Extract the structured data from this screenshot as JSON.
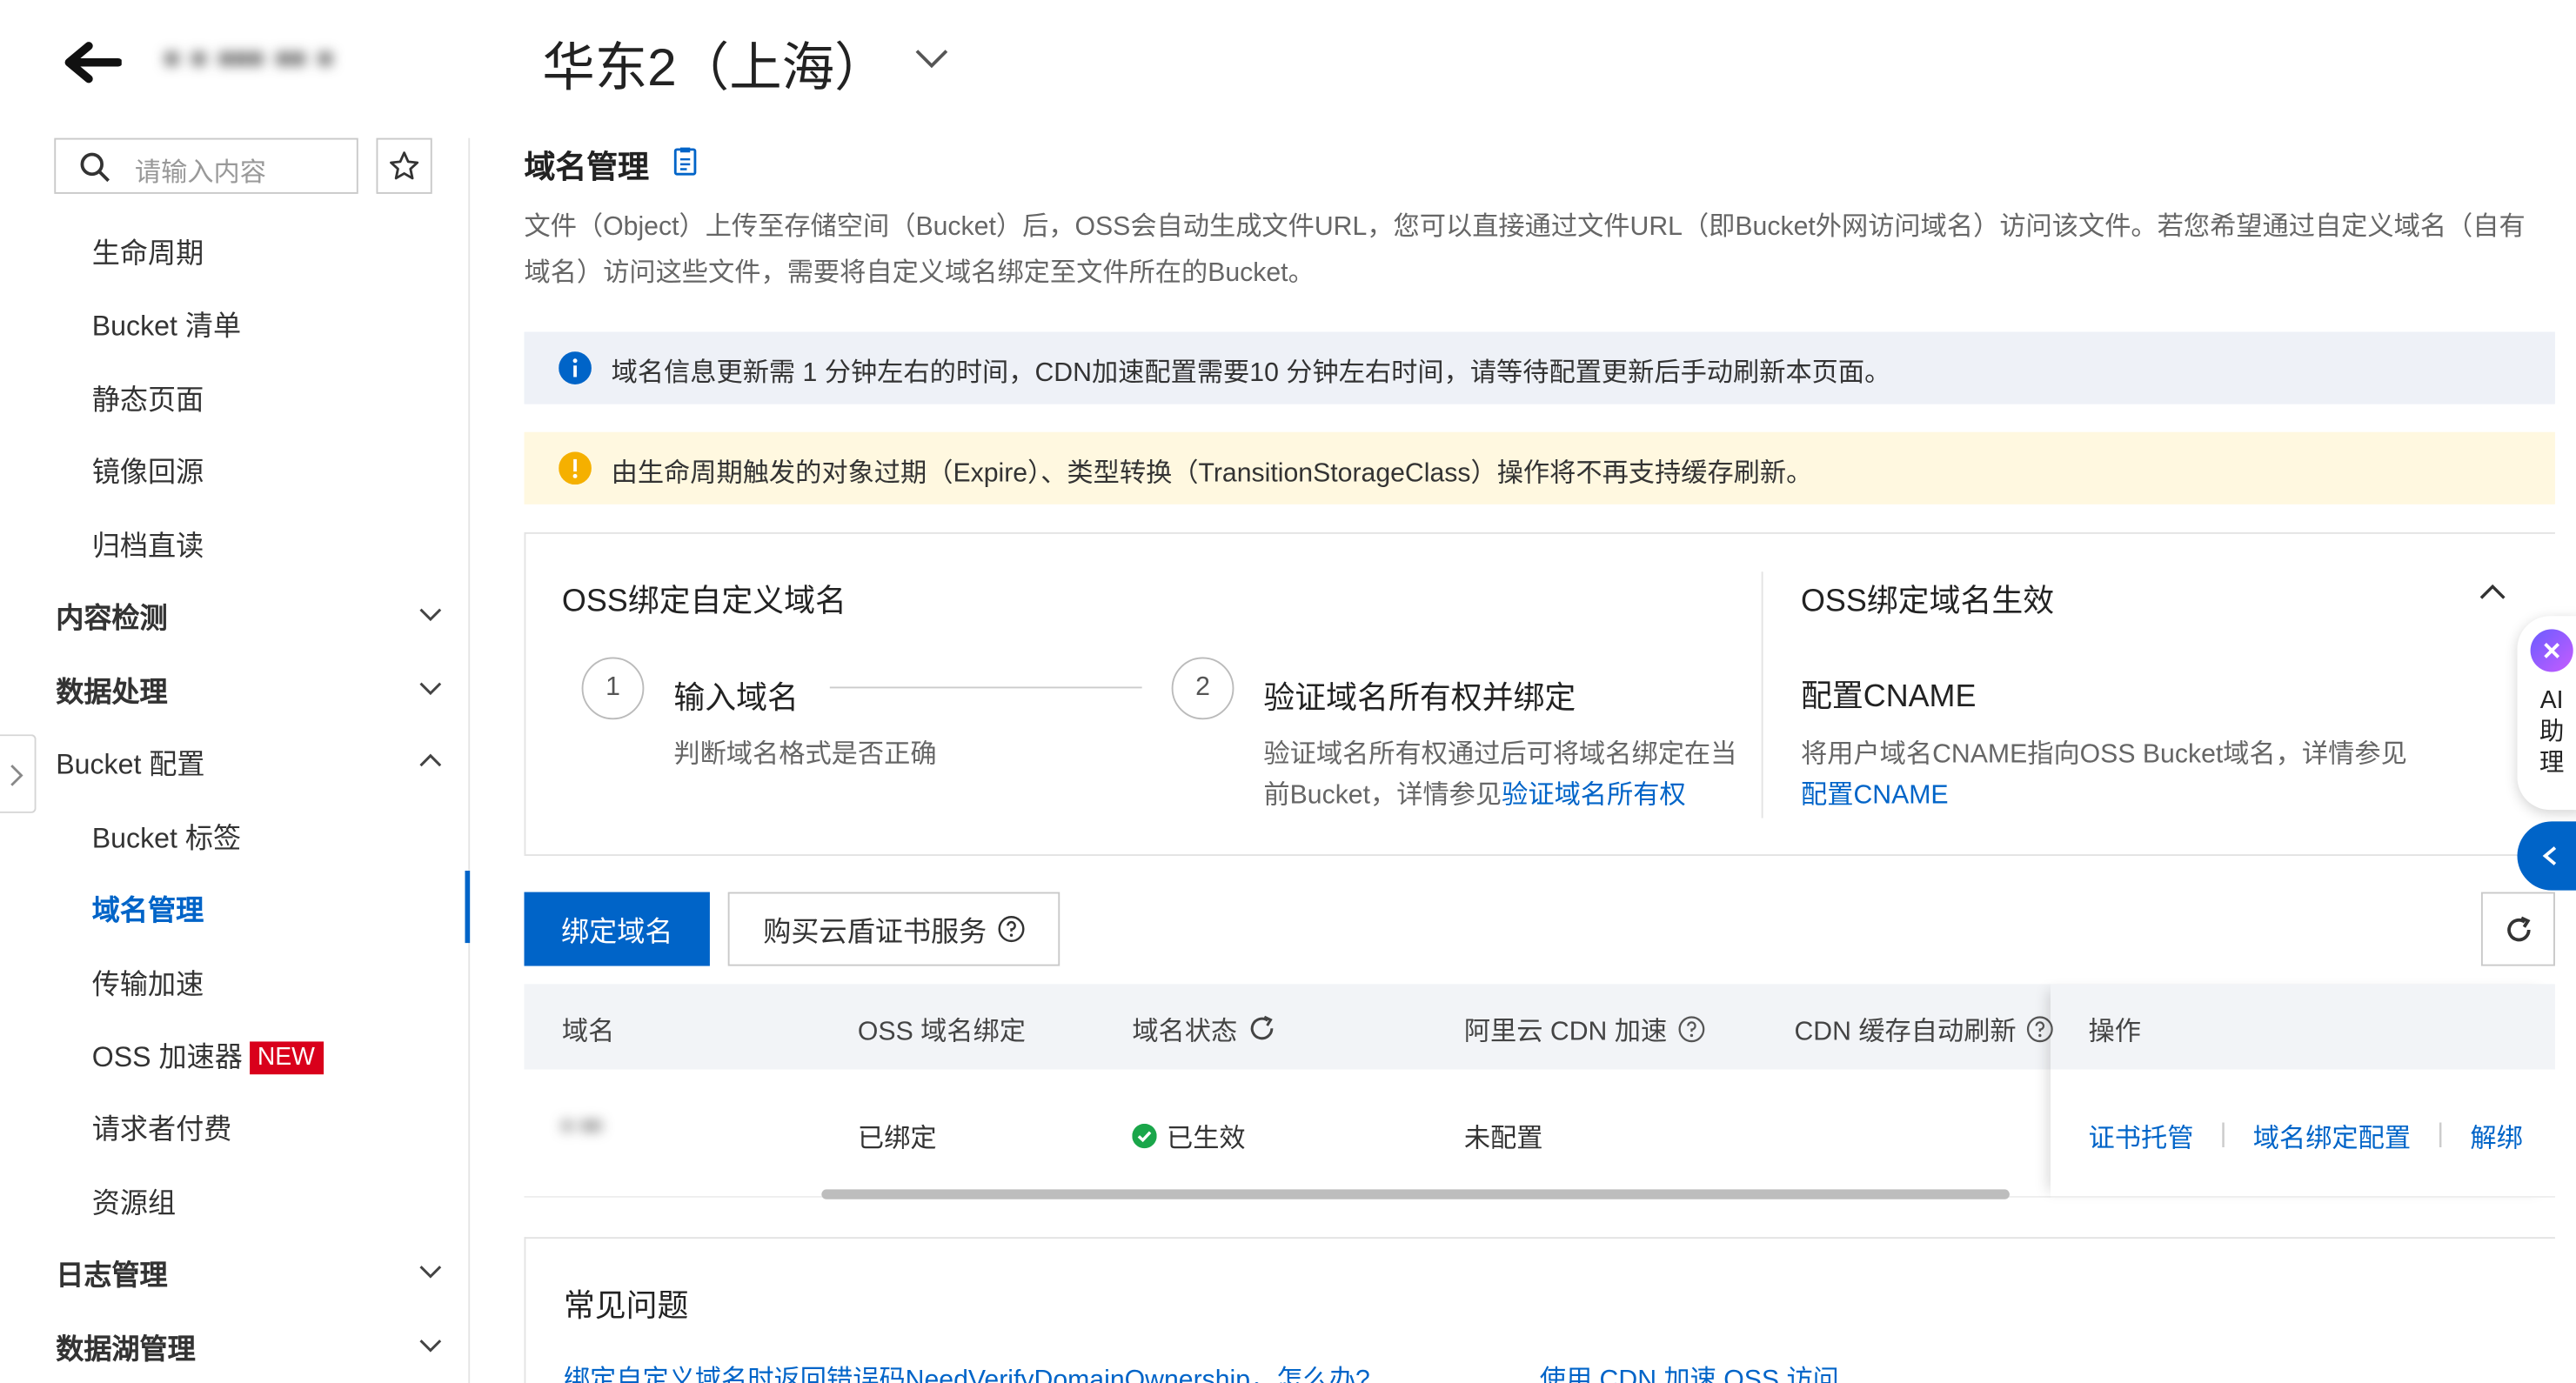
{
  "header": {
    "blurred_name": "▪ ▪ ▪▪▪ ▪▪ ▪",
    "region": "华东2（上海）"
  },
  "sidebar": {
    "search_placeholder": "请输入内容",
    "items": [
      {
        "label": "生命周期"
      },
      {
        "label": "Bucket 清单"
      },
      {
        "label": "静态页面"
      },
      {
        "label": "镜像回源"
      },
      {
        "label": "归档直读"
      },
      {
        "label": "内容检测"
      },
      {
        "label": "数据处理"
      },
      {
        "label": "Bucket 配置"
      },
      {
        "label": "Bucket 标签"
      },
      {
        "label": "域名管理"
      },
      {
        "label": "传输加速"
      },
      {
        "label": "OSS 加速器",
        "badge": "NEW"
      },
      {
        "label": "请求者付费"
      },
      {
        "label": "资源组"
      },
      {
        "label": "日志管理"
      },
      {
        "label": "数据湖管理"
      }
    ]
  },
  "main": {
    "title": "域名管理",
    "description": "文件（Object）上传至存储空间（Bucket）后，OSS会自动生成文件URL，您可以直接通过文件URL（即Bucket外网访问域名）访问该文件。若您希望通过自定义域名（自有域名）访问这些文件，需要将自定义域名绑定至文件所在的Bucket。",
    "notice_info": "域名信息更新需 1 分钟左右的时间，CDN加速配置需要10 分钟左右时间，请等待配置更新后手动刷新本页面。",
    "notice_warning": "由生命周期触发的对象过期（Expire）、类型转换（TransitionStorageClass）操作将不再支持缓存刷新。",
    "guide": {
      "left_title": "OSS绑定自定义域名",
      "step1_num": "1",
      "step1_title": "输入域名",
      "step1_desc": "判断域名格式是否正确",
      "step2_num": "2",
      "step2_title": "验证域名所有权并绑定",
      "step2_desc": "验证域名所有权通过后可将域名绑定在当前Bucket，详情参见",
      "step2_link": "验证域名所有权",
      "right_title": "OSS绑定域名生效",
      "right_sub": "配置CNAME",
      "right_desc": "将用户域名CNAME指向OSS Bucket域名，详情参见",
      "right_link": "配置CNAME"
    },
    "buttons": {
      "bind": "绑定域名",
      "buy_cert": "购买云盾证书服务"
    },
    "table": {
      "headers": [
        "域名",
        "OSS 域名绑定",
        "域名状态",
        "阿里云 CDN 加速",
        "CDN 缓存自动刷新",
        "操作"
      ],
      "row": {
        "domain": "▪ ▪▪",
        "binding": "已绑定",
        "status": "已生效",
        "cdn": "未配置",
        "ops": [
          "证书托管",
          "域名绑定配置",
          "解绑"
        ]
      }
    },
    "faq": {
      "title": "常见问题",
      "links": [
        "绑定自定义域名时返回错误码NeedVerifyDomainOwnership，怎么办?",
        "使用 CDN 加速 OSS 访问"
      ]
    }
  },
  "ai_assistant": {
    "label": "AI助理"
  },
  "colors": {
    "primary": "#0064c8",
    "badge": "#d9001b",
    "success": "#1aa64a",
    "warning": "#f5b000"
  }
}
